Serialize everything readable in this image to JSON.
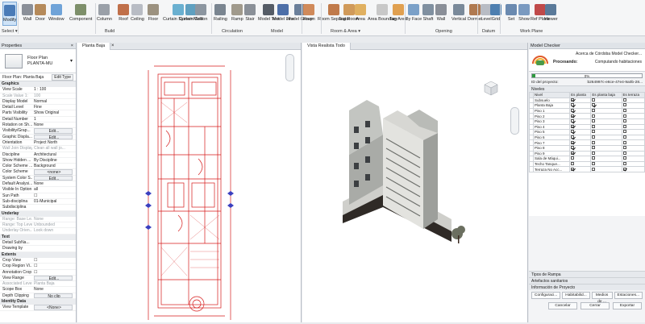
{
  "ribbon": {
    "tools": [
      {
        "label": "Modify",
        "color": "#4a7bb7",
        "selected": true
      },
      {
        "label": "Wall",
        "color": "#8a8f98"
      },
      {
        "label": "Door",
        "color": "#b58a5a"
      },
      {
        "label": "Window",
        "color": "#6fa3d8"
      },
      {
        "label": "Component",
        "color": "#7d8f6a"
      },
      {
        "label": "Column",
        "color": "#9aa0a8"
      },
      {
        "label": "Roof",
        "color": "#c0704a"
      },
      {
        "label": "Ceiling",
        "color": "#b8bcc4"
      },
      {
        "label": "Floor",
        "color": "#9c9280"
      },
      {
        "label": "Curtain System",
        "color": "#6ab0d0"
      },
      {
        "label": "Curtain Grid",
        "color": "#5fa0c0"
      },
      {
        "label": "Mullion",
        "color": "#8c96a0"
      },
      {
        "label": "Railing",
        "color": "#7a8590"
      },
      {
        "label": "Ramp",
        "color": "#a09a8c"
      },
      {
        "label": "Stair",
        "color": "#8a9098"
      },
      {
        "label": "Model Text",
        "color": "#555c66"
      },
      {
        "label": "Model Line",
        "color": "#4d6fa8"
      },
      {
        "label": "Model Group",
        "color": "#6a7f9a"
      },
      {
        "label": "Room",
        "color": "#d08a5a"
      },
      {
        "label": "Room Separator",
        "color": "#c07a4a"
      },
      {
        "label": "Tag Room",
        "color": "#d09a5a"
      },
      {
        "label": "Area",
        "color": "#e0b060"
      },
      {
        "label": "Area Boundary",
        "color": "#c8c8c8"
      },
      {
        "label": "Tag Area",
        "color": "#e0a050"
      },
      {
        "label": "By Face",
        "color": "#7aa0c8"
      },
      {
        "label": "Shaft",
        "color": "#8090a0"
      },
      {
        "label": "Wall",
        "color": "#8a8f98"
      },
      {
        "label": "Vertical",
        "color": "#7a8a9a"
      },
      {
        "label": "Dormer",
        "color": "#b07a50"
      },
      {
        "label": "Level",
        "color": "#b8bcc4"
      },
      {
        "label": "Grid",
        "color": "#4d7fb0"
      },
      {
        "label": "Set",
        "color": "#6a8ab0"
      },
      {
        "label": "Show",
        "color": "#7a9ac0"
      },
      {
        "label": "Ref Plane",
        "color": "#c04a4a"
      },
      {
        "label": "Viewer",
        "color": "#5a7a9a"
      }
    ],
    "panels": [
      {
        "label": "Select ▾"
      },
      {
        "label": "Build"
      },
      {
        "label": "Circulation"
      },
      {
        "label": "Model"
      },
      {
        "label": "Room & Area ▾"
      },
      {
        "label": "Opening"
      },
      {
        "label": "Datum"
      },
      {
        "label": "Work Plane"
      }
    ]
  },
  "properties": {
    "title": "Properties",
    "type_line1": "Floor Plan",
    "type_line2": "PLANTA-MU",
    "instance_selector": "Floor Plan: Planta Baja",
    "edit_type": "Edit Type",
    "rows": [
      {
        "group": "Graphics"
      },
      {
        "k": "View Scale",
        "v": "1 : 100"
      },
      {
        "k": "Scale Value 1:",
        "v": "100",
        "dim": true
      },
      {
        "k": "Display Model",
        "v": "Normal"
      },
      {
        "k": "Detail Level",
        "v": "Fine"
      },
      {
        "k": "Parts Visibility",
        "v": "Show Original"
      },
      {
        "k": "Detail Number",
        "v": "1"
      },
      {
        "k": "Rotation on Sh...",
        "v": "None"
      },
      {
        "k": "Visibility/Grap...",
        "v": "Edit...",
        "btn": true
      },
      {
        "k": "Graphic Displa...",
        "v": "Edit...",
        "btn": true
      },
      {
        "k": "Orientation",
        "v": "Project North"
      },
      {
        "k": "Wall Join Display",
        "v": "Clean all wall jo...",
        "dim": true
      },
      {
        "k": "Discipline",
        "v": "Architectural"
      },
      {
        "k": "Show Hidden ...",
        "v": "By Discipline"
      },
      {
        "k": "Color Scheme ...",
        "v": "Background"
      },
      {
        "k": "Color Scheme",
        "v": "<none>",
        "btn": true
      },
      {
        "k": "System Color S...",
        "v": "Edit...",
        "btn": true
      },
      {
        "k": "Default Analysi...",
        "v": "None"
      },
      {
        "k": "Visible In Option",
        "v": "all"
      },
      {
        "k": "Sun Path",
        "v": "☐"
      },
      {
        "k": "Sub-disciplina",
        "v": "01-Municipal"
      },
      {
        "k": "Subdisciplina",
        "v": ""
      },
      {
        "group": "Underlay"
      },
      {
        "k": "Range: Base Le...",
        "v": "None",
        "dim": true
      },
      {
        "k": "Range: Top Level",
        "v": "Unbounded",
        "dim": true
      },
      {
        "k": "Underlay Orien...",
        "v": "Look down",
        "dim": true
      },
      {
        "group": "Text"
      },
      {
        "k": "Detail SubNa...",
        "v": ""
      },
      {
        "k": "Drawing by",
        "v": ""
      },
      {
        "group": "Extents"
      },
      {
        "k": "Crop View",
        "v": "☐"
      },
      {
        "k": "Crop Region Vi...",
        "v": "☐"
      },
      {
        "k": "Annotation Crop",
        "v": "☐"
      },
      {
        "k": "View Range",
        "v": "Edit...",
        "btn": true
      },
      {
        "k": "Associated Level",
        "v": "Planta Baja",
        "dim": true
      },
      {
        "k": "Scope Box",
        "v": "None"
      },
      {
        "k": "Depth Clipping",
        "v": "No clip",
        "btn": true
      },
      {
        "group": "Identity Data"
      },
      {
        "k": "View Template",
        "v": "<None>",
        "btn": true
      }
    ]
  },
  "views": {
    "plan_tab": "Planta Baja",
    "render_tab": "Vista Realista Todo",
    "close": "×"
  },
  "model_checker": {
    "title": "Model Checker",
    "project": "Acerca de Córdoba Model Checker...",
    "status_label": "Procesando:",
    "status_value": "Computando habitaciones",
    "progress_text": "0%",
    "progress_pct": 3,
    "id_label": "ID del proyecto:",
    "id_value": "b264997c-e6ce-47e4-9a0b-28...",
    "levels_title": "Niveles",
    "columns": [
      "Nivel",
      "Es planta",
      "Es planta baja",
      "Es terraza"
    ],
    "levels": [
      {
        "n": "Subsuelo",
        "p": true,
        "b": false,
        "t": false
      },
      {
        "n": "Planta Baja",
        "p": true,
        "b": true,
        "t": false
      },
      {
        "n": "Piso 1",
        "p": true,
        "b": false,
        "t": false
      },
      {
        "n": "Piso 2",
        "p": true,
        "b": false,
        "t": false
      },
      {
        "n": "Piso 3",
        "p": true,
        "b": false,
        "t": false
      },
      {
        "n": "Piso 4",
        "p": true,
        "b": false,
        "t": false
      },
      {
        "n": "Piso 5",
        "p": true,
        "b": false,
        "t": false
      },
      {
        "n": "Piso 6",
        "p": true,
        "b": false,
        "t": false
      },
      {
        "n": "Piso 7",
        "p": true,
        "b": false,
        "t": false
      },
      {
        "n": "Piso 8",
        "p": true,
        "b": false,
        "t": false
      },
      {
        "n": "Piso 9",
        "p": true,
        "b": false,
        "t": false
      },
      {
        "n": "Sala de Máqui...",
        "p": false,
        "b": false,
        "t": false
      },
      {
        "n": "Techo Tanque...",
        "p": false,
        "b": false,
        "t": false
      },
      {
        "n": "Terraza No Acc...",
        "p": true,
        "b": false,
        "t": true
      }
    ],
    "sections": [
      "Tipos de Rampa",
      "Artefactos sanitarios",
      "Información de Proyecto"
    ],
    "tabs": [
      "Configuraci...",
      "Habitabilid...",
      "Medios de ...",
      "Estaciones..."
    ],
    "cancel": "Cancelar",
    "close_btn": "Cerrar",
    "export": "Exportar"
  }
}
